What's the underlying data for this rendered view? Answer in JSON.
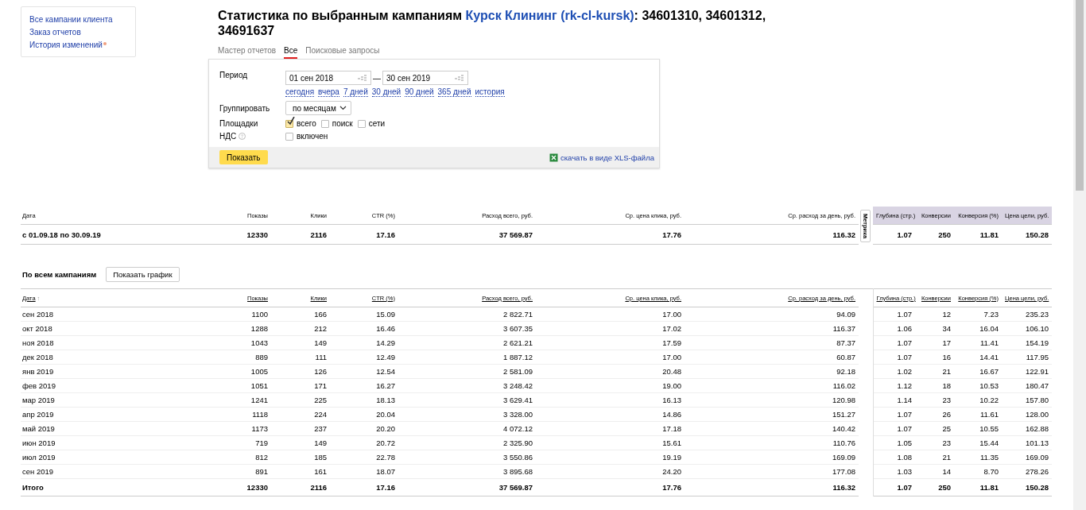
{
  "sidebar": {
    "links": [
      {
        "label": "Все кампании клиента",
        "badge": false
      },
      {
        "label": "Заказ отчетов",
        "badge": false
      },
      {
        "label": "История изменений",
        "badge": true
      }
    ]
  },
  "title": {
    "prefix": "Статистика по выбранным кампаниям ",
    "link": "Курск Клининг (rk-cl-kursk)",
    "suffix": ": 34601310, 34601312, 34691637"
  },
  "tabs": [
    {
      "label": "Мастер отчетов",
      "selected": false
    },
    {
      "label": "Все",
      "selected": true
    },
    {
      "label": "Поисковые запросы",
      "selected": false
    }
  ],
  "form": {
    "period_label": "Период",
    "date_from": "01 сен 2018",
    "dash": "—",
    "date_to": "30 сен 2019",
    "quick_links": [
      "сегодня",
      "вчера",
      "7 дней",
      "30 дней",
      "90 дней",
      "365 дней",
      "история"
    ],
    "group_label": "Группировать",
    "group_value": "по месяцам",
    "platforms_label": "Площадки",
    "platforms": [
      {
        "label": "всего",
        "checked": true
      },
      {
        "label": "поиск",
        "checked": false
      },
      {
        "label": "сети",
        "checked": false
      }
    ],
    "vat_label": "НДС",
    "vat": {
      "label": "включен",
      "checked": false
    },
    "submit": "Показать",
    "download": "скачать в виде XLS-файла"
  },
  "summary": {
    "columns": [
      {
        "label": "Дата",
        "kind": "direct"
      },
      {
        "label": "Показы",
        "kind": "direct"
      },
      {
        "label": "Клики",
        "kind": "direct"
      },
      {
        "label": "CTR (%)",
        "kind": "direct"
      },
      {
        "label": "Расход всего, руб.",
        "kind": "direct"
      },
      {
        "label": "Ср. цена клика, руб.",
        "kind": "direct"
      },
      {
        "label": "Ср. расход за день, руб.",
        "kind": "direct"
      },
      {
        "label": "Глубина (стр.)",
        "kind": "metrika"
      },
      {
        "label": "Конверсии",
        "kind": "metrika"
      },
      {
        "label": "Конверсия (%)",
        "kind": "metrika"
      },
      {
        "label": "Цена цели, руб.",
        "kind": "metrika"
      }
    ],
    "metrika_tab": "Метрика",
    "row": [
      "с 01.09.18 по 30.09.19",
      "12330",
      "2116",
      "17.16",
      "37 569.87",
      "17.76",
      "116.32",
      "1.07",
      "250",
      "11.81",
      "150.28"
    ]
  },
  "section": {
    "title": "По всем кампаниям",
    "button": "Показать график"
  },
  "table": {
    "columns": [
      "Дата",
      "Показы",
      "Клики",
      "CTR (%)",
      "Расход всего, руб.",
      "Ср. цена клика, руб.",
      "Ср. расход за день, руб.",
      "Глубина (стр.)",
      "Конверсии",
      "Конверсия (%)",
      "Цена цели, руб."
    ],
    "sort_mark": "↑",
    "rows": [
      [
        "сен 2018",
        "1100",
        "166",
        "15.09",
        "2 822.71",
        "17.00",
        "94.09",
        "1.07",
        "12",
        "7.23",
        "235.23"
      ],
      [
        "окт 2018",
        "1288",
        "212",
        "16.46",
        "3 607.35",
        "17.02",
        "116.37",
        "1.06",
        "34",
        "16.04",
        "106.10"
      ],
      [
        "ноя 2018",
        "1043",
        "149",
        "14.29",
        "2 621.21",
        "17.59",
        "87.37",
        "1.07",
        "17",
        "11.41",
        "154.19"
      ],
      [
        "дек 2018",
        "889",
        "111",
        "12.49",
        "1 887.12",
        "17.00",
        "60.87",
        "1.07",
        "16",
        "14.41",
        "117.95"
      ],
      [
        "янв 2019",
        "1005",
        "126",
        "12.54",
        "2 581.09",
        "20.48",
        "92.18",
        "1.02",
        "21",
        "16.67",
        "122.91"
      ],
      [
        "фев 2019",
        "1051",
        "171",
        "16.27",
        "3 248.42",
        "19.00",
        "116.02",
        "1.12",
        "18",
        "10.53",
        "180.47"
      ],
      [
        "мар 2019",
        "1241",
        "225",
        "18.13",
        "3 629.41",
        "16.13",
        "120.98",
        "1.14",
        "23",
        "10.22",
        "157.80"
      ],
      [
        "апр 2019",
        "1118",
        "224",
        "20.04",
        "3 328.00",
        "14.86",
        "151.27",
        "1.07",
        "26",
        "11.61",
        "128.00"
      ],
      [
        "май 2019",
        "1173",
        "237",
        "20.20",
        "4 072.12",
        "17.18",
        "140.42",
        "1.07",
        "25",
        "10.55",
        "162.88"
      ],
      [
        "июн 2019",
        "719",
        "149",
        "20.72",
        "2 325.90",
        "15.61",
        "110.76",
        "1.05",
        "23",
        "15.44",
        "101.13"
      ],
      [
        "июл 2019",
        "812",
        "185",
        "22.78",
        "3 550.86",
        "19.19",
        "169.09",
        "1.08",
        "21",
        "11.35",
        "169.09"
      ],
      [
        "сен 2019",
        "891",
        "161",
        "18.07",
        "3 895.68",
        "24.20",
        "177.08",
        "1.03",
        "14",
        "8.70",
        "278.26"
      ]
    ],
    "total": [
      "Итого",
      "12330",
      "2116",
      "17.16",
      "37 569.87",
      "17.76",
      "116.32",
      "1.07",
      "250",
      "11.81",
      "150.28"
    ]
  }
}
